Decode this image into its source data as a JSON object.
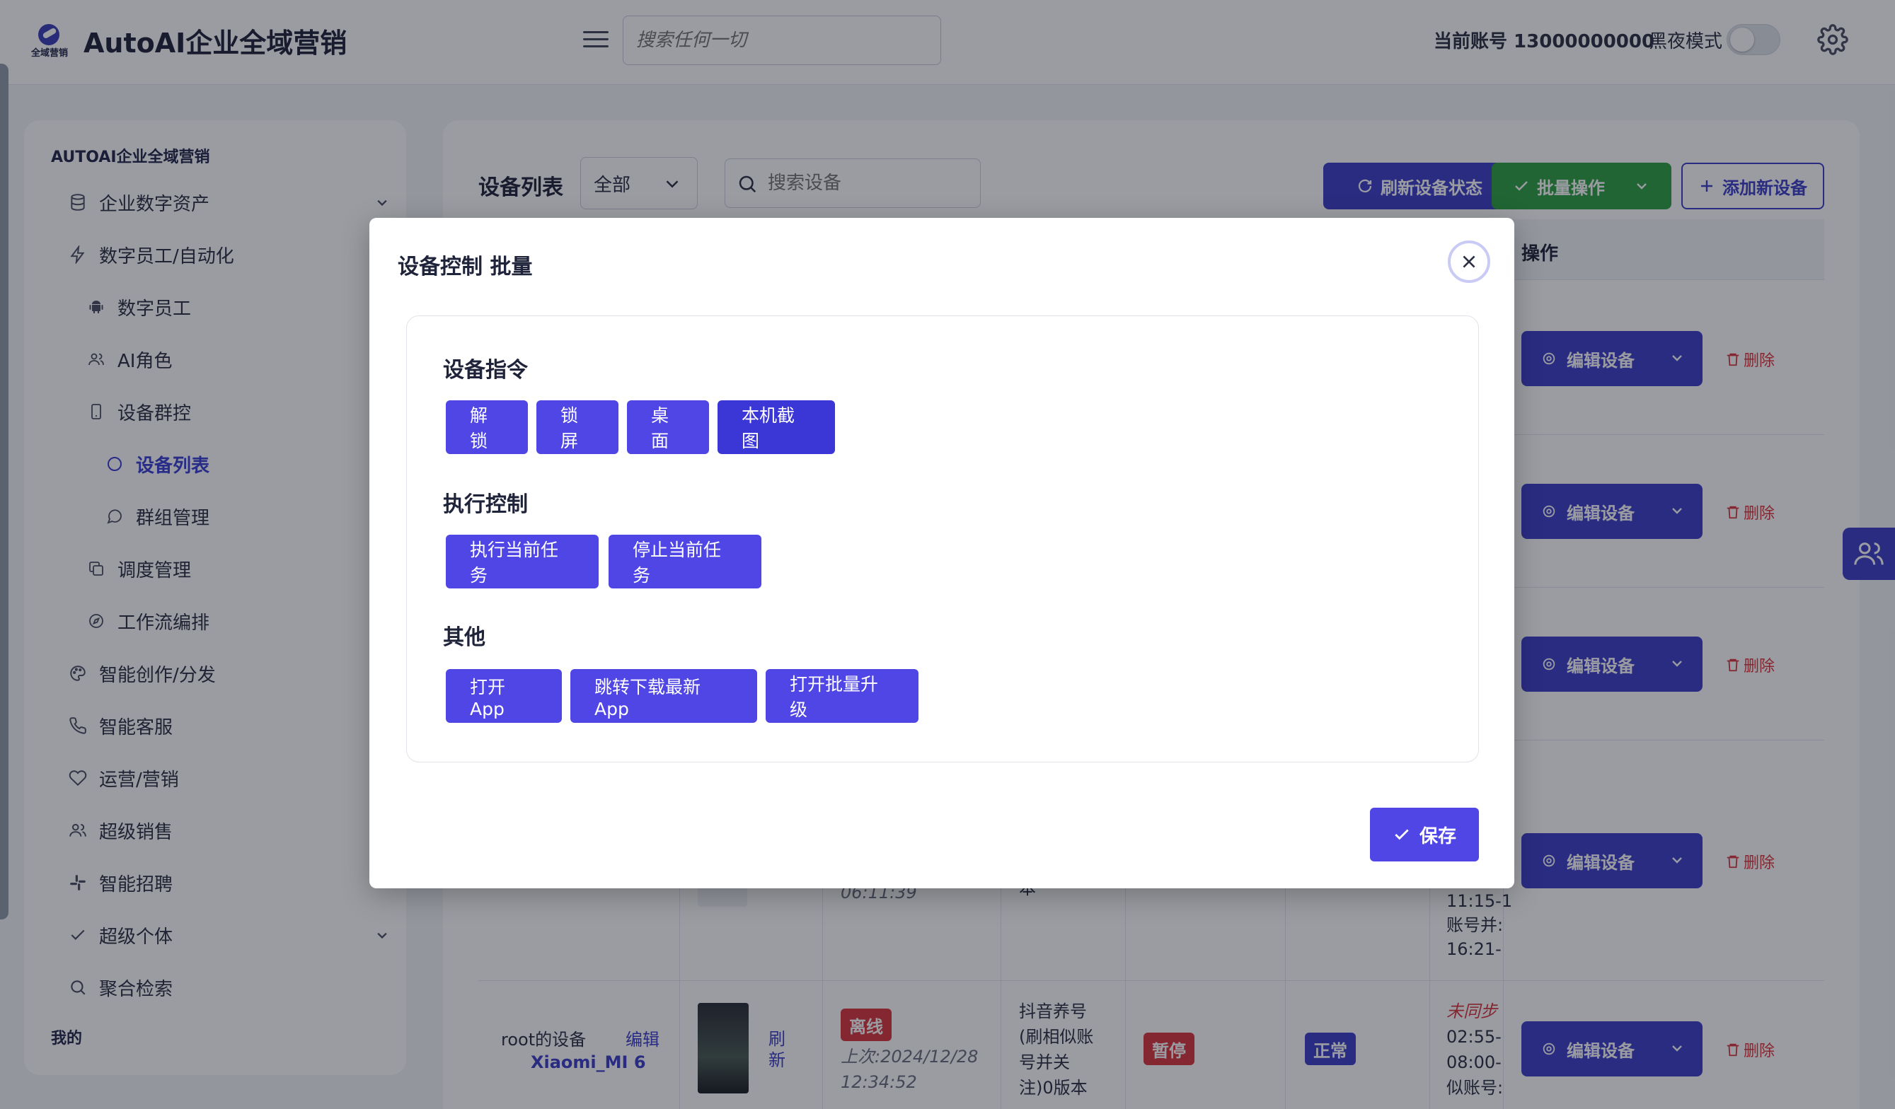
{
  "header": {
    "app_title": "AutoAI企业全域营销",
    "logo_caption": "全域营销",
    "search_placeholder": "搜索任何一切",
    "account_label": "当前账号 13000000000",
    "dark_mode_label": "黑夜模式",
    "dark_mode_on": false
  },
  "sidebar": {
    "section_title": "AUTOAI企业全域营销",
    "items": [
      {
        "label": "企业数字资产",
        "icon": "database-icon",
        "expanded": false
      },
      {
        "label": "数字员工/自动化",
        "icon": "lightning-icon",
        "expanded": true
      },
      {
        "label": "数字员工",
        "icon": "android-icon"
      },
      {
        "label": "AI角色",
        "icon": "users-icon"
      },
      {
        "label": "设备群控",
        "icon": "phone-icon",
        "expanded": true
      },
      {
        "label": "设备列表",
        "icon": "circle-icon",
        "active": true
      },
      {
        "label": "群组管理",
        "icon": "chat-icon"
      },
      {
        "label": "调度管理",
        "icon": "copy-icon"
      },
      {
        "label": "工作流编排",
        "icon": "compass-icon"
      },
      {
        "label": "智能创作/分发",
        "icon": "palette-icon",
        "expanded": false
      },
      {
        "label": "智能客服",
        "icon": "phone-call-icon",
        "expanded": false
      },
      {
        "label": "运营/营销",
        "icon": "heart-icon",
        "expanded": false
      },
      {
        "label": "超级销售",
        "icon": "users-icon",
        "expanded": false
      },
      {
        "label": "智能招聘",
        "icon": "slack-icon",
        "expanded": false
      },
      {
        "label": "超级个体",
        "icon": "check-icon",
        "expanded": false
      },
      {
        "label": "聚合检索",
        "icon": "search-icon"
      }
    ],
    "footer_section": "我的"
  },
  "main": {
    "title": "设备列表",
    "filter_value": "全部",
    "search_placeholder": "搜索设备",
    "refresh_label": "刷新设备状态",
    "batch_label": "批量操作",
    "add_label": "添加新设备",
    "col_operation": "操作",
    "edit_label": "编辑设备",
    "delete_label": "删除",
    "row_partial": {
      "time_tail": "06:11:39",
      "text_tail": "本",
      "log_lines": [
        "11:15-1",
        "账号并:",
        "16:21-"
      ]
    },
    "row_last": {
      "device_name": "root的设备",
      "edit_link": "编辑",
      "model": "Xiaomi_MI 6",
      "refresh_link": "刷新",
      "status": "离线",
      "last_seen": "上次:2024/12/28 12:34:52",
      "task_lines": [
        "抖音养号",
        "(刷相似账",
        "号并关",
        "注)0版本"
      ],
      "run_state": "暂停",
      "health": "正常",
      "sync_label": "未同步",
      "log_lines": [
        "02:55-",
        "08:00-",
        "似账号:"
      ]
    }
  },
  "modal": {
    "title": "设备控制 批量",
    "groups": [
      {
        "title": "设备指令",
        "buttons": [
          "解锁",
          "锁屏",
          "桌面",
          "本机截图"
        ]
      },
      {
        "title": "执行控制",
        "buttons": [
          "执行当前任务",
          "停止当前任务"
        ]
      },
      {
        "title": "其他",
        "buttons": [
          "打开App",
          "跳转下载最新App",
          "打开批量升级"
        ]
      }
    ],
    "save_label": "保存"
  },
  "colors": {
    "primary": "#4f46e5",
    "primary_dark": "#3e3fc9",
    "success": "#2ea043",
    "danger": "#d9363e"
  }
}
